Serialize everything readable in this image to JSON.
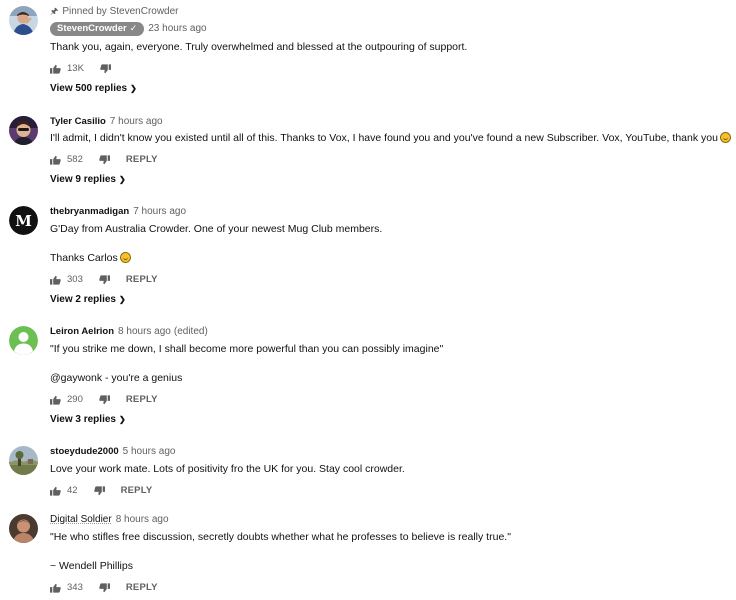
{
  "comments": [
    {
      "pinned_label": "Pinned by StevenCrowder",
      "author": "StevenCrowder",
      "time": "23 hours ago",
      "text": "Thank you, again, everyone. Truly overwhelmed and blessed at the outpouring of support.",
      "likes": "13K",
      "view_replies": "View 500 replies"
    },
    {
      "author": "Tyler Casilio",
      "time": "7 hours ago",
      "text": "I'll admit, I didn't know you existed until all of this. Thanks to Vox, I have found you and you've found a new Subscriber. Vox, YouTube, thank you",
      "likes": "582",
      "reply": "REPLY",
      "view_replies": "View 9 replies"
    },
    {
      "author": "thebryanmadigan",
      "time": "7 hours ago",
      "text": "G'Day from Australia Crowder. One of your newest Mug Club members.",
      "text2": "Thanks Carlos",
      "likes": "303",
      "reply": "REPLY",
      "view_replies": "View 2 replies"
    },
    {
      "author": "Leiron Aelrion",
      "time": "8 hours ago",
      "edited": "(edited)",
      "text": "\"If you strike me down, I shall become more powerful than you can possibly imagine\"",
      "text2": "@gaywonk - you're a genius",
      "likes": "290",
      "reply": "REPLY",
      "view_replies": "View 3 replies"
    },
    {
      "author": "stoeydude2000",
      "time": "5 hours ago",
      "text": "Love your work mate. Lots of positivity fro the UK for you. Stay cool crowder.",
      "likes": "42",
      "reply": "REPLY"
    },
    {
      "author": "Digital Soldier",
      "time": "8 hours ago",
      "text": "\"He who stifles free discussion, secretly doubts whether what he professes to believe is really true.\"",
      "text2": "~ Wendell Phillips",
      "likes": "343",
      "reply": "REPLY"
    }
  ],
  "avatar_letters": {
    "bryan": "M"
  },
  "colors": {
    "author_chip_bg": "#888888",
    "meta_text": "#606060",
    "emoji": "#f6c12b",
    "leiron_avatar": "#6cbf52"
  },
  "icons": [
    "pin-icon",
    "thumbs-up-icon",
    "thumbs-down-icon",
    "chevron-down-icon",
    "check-icon",
    "smiley-emoji-icon"
  ]
}
